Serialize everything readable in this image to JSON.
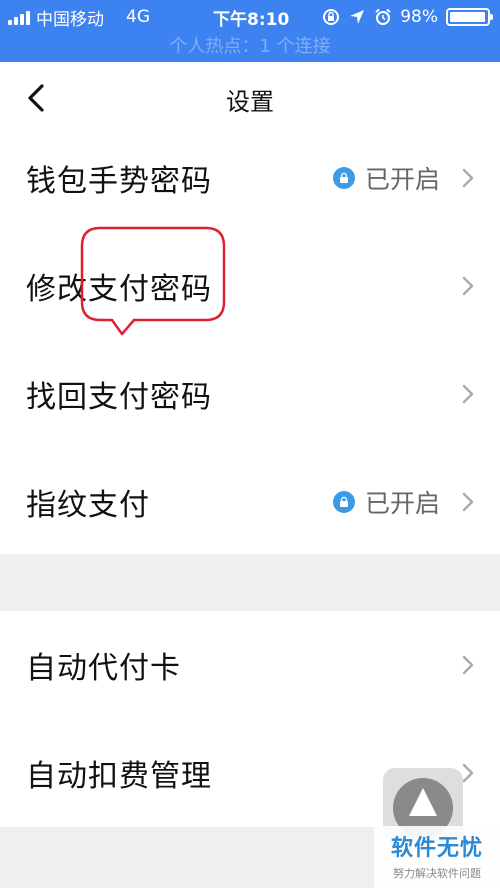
{
  "status_bar": {
    "carrier": "中国移动",
    "network": "4G",
    "time": "下午8:10",
    "battery": "98%",
    "battery_level": 0.98,
    "hotspot_text": "个人热点：1 个连接"
  },
  "nav": {
    "title": "设置",
    "back_icon": "chevron-left-icon"
  },
  "settings_group_1": [
    {
      "label": "钱包手势密码",
      "status": "已开启",
      "icon": "lock-icon"
    },
    {
      "label": "修改支付密码",
      "status": ""
    },
    {
      "label": "找回支付密码",
      "status": ""
    },
    {
      "label": "指纹支付",
      "status": "已开启",
      "icon": "lock-icon"
    }
  ],
  "settings_group_2": [
    {
      "label": "自动代付卡",
      "status": ""
    },
    {
      "label": "自动扣费管理",
      "status": ""
    }
  ],
  "watermark": {
    "title": "软件无忧",
    "subtitle": "努力解决软件问题"
  },
  "colors": {
    "status_bar": "#3c82f0",
    "annotation": "#e02030",
    "badge": "#3c9be6",
    "watermark_title": "#2a8ad8"
  }
}
